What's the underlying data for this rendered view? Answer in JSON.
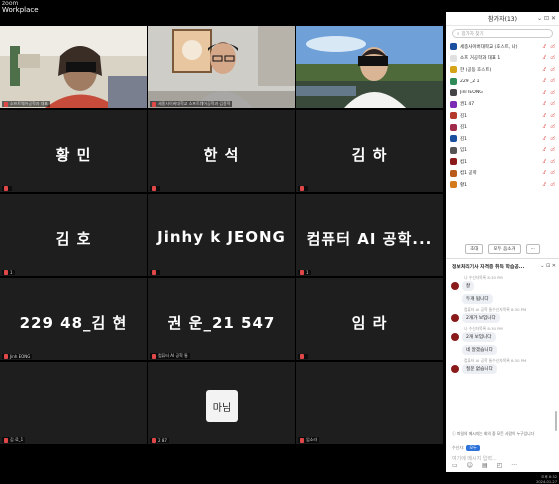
{
  "app": {
    "brand": "zoom",
    "name": "Workplace"
  },
  "tiles": [
    {
      "big": "",
      "label": "소프트웨어공학과 대표",
      "video": "woman"
    },
    {
      "big": "",
      "label": "세종사이버대학교 소프트웨어공학과 김종혁",
      "video": "man-glasses",
      "active": true
    },
    {
      "big": "",
      "label": "",
      "video": "outdoor"
    },
    {
      "big": "황  민",
      "label": ""
    },
    {
      "big": "한  석",
      "label": ""
    },
    {
      "big": "김  하",
      "label": ""
    },
    {
      "big": "김  호",
      "label": "1"
    },
    {
      "big": "Jinhy    k JEONG",
      "label": ""
    },
    {
      "big": "컴퓨터 AI 공학...",
      "label": "1"
    },
    {
      "big": "229    48_김  현",
      "label": "Jinh    EONG"
    },
    {
      "big": "권  운_21    547",
      "label": "컴퓨터 AI 공학    통"
    },
    {
      "big": "임  라",
      "label": ""
    },
    {
      "big": "",
      "label": "김    료_1"
    },
    {
      "big": "",
      "label": "2    87"
    },
    {
      "big": "",
      "label": "임소라"
    }
  ],
  "avatar_text": "마님",
  "participants": {
    "title": "참가자(13)",
    "search_placeholder": "참가자 찾기",
    "items": [
      {
        "name": "세종사이버대학교 (호스트, 나)",
        "color": "#1a4fa0"
      },
      {
        "name": "소프    거공학과 대표 1",
        "color": "#e0e0e0"
      },
      {
        "name": "한    (공동 호스트)",
        "color": "#d4a31a"
      },
      {
        "name": "229    _2     1",
        "color": "#2e8b57"
      },
      {
        "name": "Jinl    IEONG",
        "color": "#444"
      },
      {
        "name": "권1    47",
        "color": "#7a2ab3"
      },
      {
        "name": "김1",
        "color": "#b33a2a"
      },
      {
        "name": "김1",
        "color": "#a02a4a"
      },
      {
        "name": "김1",
        "color": "#1a4fa0"
      },
      {
        "name": "임1",
        "color": "#555"
      },
      {
        "name": "컴1",
        "color": "#8a1a1a"
      },
      {
        "name": "컴1    공학     ",
        "color": "#b85a1a"
      },
      {
        "name": "황1",
        "color": "#d47a1a"
      }
    ],
    "invite_label": "초대",
    "mute_all_label": "모두 음소거"
  },
  "chat": {
    "title": "정보처리기사 자격증 취득 학습공...",
    "messages": [
      {
        "meta": "",
        "text": ""
      },
      {
        "meta": "나 수신자목록 8:30 PM",
        "text": "잘"
      },
      {
        "meta": "",
        "text": "두개 됩니다"
      },
      {
        "meta": "컴퓨터 AI 공학    통수신자목록 8:30 PM",
        "text": "2개가 보입니다"
      },
      {
        "meta": "나 수신자목록 8:30 PM",
        "text": "2개 보입니다"
      },
      {
        "meta": "",
        "text": "네 알겠습니다"
      },
      {
        "meta": "컴퓨터 AI 공학    통수신자목록 8:30 PM",
        "text": "질문 없습니다"
      }
    ],
    "notice": "파일의 메시지는 회의 중 모든 사람이 누구입니다",
    "recipient_label": "수신자:",
    "recipient_value": "모두",
    "input_placeholder": "여기에 메시지 입력..."
  },
  "status": {
    "line1": "오후 8:32",
    "line2": "2024-01-27"
  }
}
